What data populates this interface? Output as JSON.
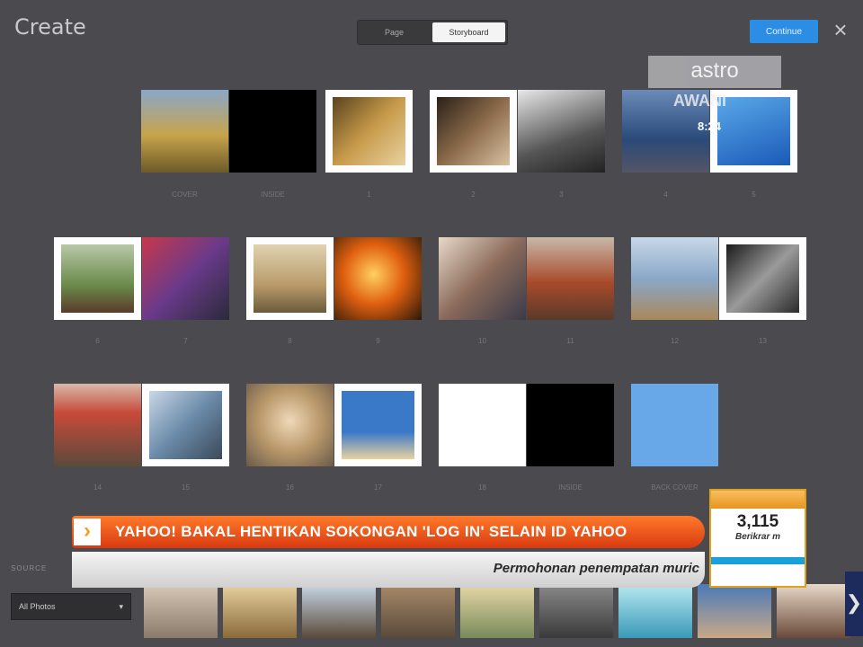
{
  "header": {
    "title": "Create",
    "tabs": [
      {
        "label": "Page",
        "active": false
      },
      {
        "label": "Storyboard",
        "active": true
      }
    ],
    "done_label": "Continue",
    "close_icon": "×"
  },
  "overlay": {
    "brand": "astro",
    "channel": "AWANI",
    "time": "8:24"
  },
  "grid": {
    "rows": [
      {
        "tiles": [
          {
            "name": "cover-front",
            "bg": "linear-gradient(#8aa7c8 0%, #c7a44a 55%, #6d5a2a 100%)",
            "framed": false
          },
          {
            "name": "cover-inside",
            "bg": "#000000",
            "framed": false
          },
          {
            "name": "page-1",
            "bg": "linear-gradient(135deg,#5a4320,#c79a4a,#e8d2a0)",
            "framed": true
          },
          {
            "name": "page-2",
            "bg": "linear-gradient(135deg,#2a2018,#8a6a4a,#d8c2a2)",
            "framed": true
          },
          {
            "name": "page-3",
            "bg": "linear-gradient(160deg,#e8e8e8,#555 60%,#222)",
            "framed": false
          },
          {
            "name": "page-4",
            "bg": "linear-gradient(#6a8ab8,#2a4a7a 60%,#556)",
            "framed": false
          },
          {
            "name": "page-5",
            "bg": "linear-gradient(160deg,#5aa8e8,#1a5ab8)",
            "framed": true
          }
        ],
        "labels": [
          "COVER",
          "INSIDE",
          "1",
          "2",
          "3",
          "4",
          "5"
        ]
      },
      {
        "tiles": [
          {
            "name": "page-6",
            "bg": "linear-gradient(#b8c8a8,#6a8a4a 60%,#5a3a2a)",
            "framed": true
          },
          {
            "name": "page-7",
            "bg": "linear-gradient(135deg,#c8384a,#6a3a8a,#2a2a3a)",
            "framed": false
          },
          {
            "name": "page-8",
            "bg": "linear-gradient(#e0d2b0,#b89a6a 60%,#6a5a3a)",
            "framed": true
          },
          {
            "name": "page-9",
            "bg": "radial-gradient(circle at 45% 45%,#ffd060,#e06010 45%,#2a1808)",
            "framed": false
          },
          {
            "name": "page-10",
            "bg": "linear-gradient(135deg,#e8d8c8,#8a6a5a 50%,#3a3a4a)",
            "framed": false
          },
          {
            "name": "page-11",
            "bg": "linear-gradient(#c8b8a8,#a84a2a 55%,#5a3a2a)",
            "framed": false
          },
          {
            "name": "page-12",
            "bg": "linear-gradient(#c8d8e8,#8aa8c8 50%,#a8885a)",
            "framed": false
          },
          {
            "name": "page-13",
            "bg": "linear-gradient(135deg,#1a1a1a,#9a9a9a,#2a2a2a)",
            "framed": true
          }
        ],
        "labels": [
          "6",
          "7",
          "8",
          "9",
          "10",
          "11",
          "12",
          "13"
        ]
      },
      {
        "tiles": [
          {
            "name": "page-14",
            "bg": "linear-gradient(#d8b8a8,#c84a3a 35%,#5a4a3a)",
            "framed": false
          },
          {
            "name": "page-15",
            "bg": "linear-gradient(135deg,#c8d8e8,#6a8aa8,#3a4a5a)",
            "framed": true
          },
          {
            "name": "page-16",
            "bg": "radial-gradient(circle at 50% 45%,#f0d8b8,#b8986a 50%,#6a5a4a)",
            "framed": false
          },
          {
            "name": "page-17",
            "bg": "linear-gradient(#3a78c8 0%,#3a78c8 60%,#e8d2a0)",
            "framed": true
          },
          {
            "name": "page-18",
            "bg": "#ffffff",
            "framed": false
          },
          {
            "name": "back-inside",
            "bg": "#000000",
            "framed": false
          },
          {
            "name": "back-cover",
            "bg": "#69a8e8",
            "framed": false
          }
        ],
        "labels": [
          "14",
          "15",
          "16",
          "17",
          "18",
          "INSIDE",
          "BACK COVER"
        ]
      }
    ]
  },
  "ticker": {
    "headline": "YAHOO! BAKAL HENTIKAN SOKONGAN 'LOG IN' SELAIN ID YAHOO",
    "subline": "Permohonan penempatan muric",
    "counter_value": "3,115",
    "counter_sub": "Berikrar m"
  },
  "bottom": {
    "source_label": "SOURCE",
    "source_value": "All Photos",
    "next_icon": "❯",
    "strip": [
      "linear-gradient(#d8c8b8,#8a7a6a)",
      "linear-gradient(#e8d2a0,#8a6a3a)",
      "linear-gradient(#c8d8e8,#5a4a3a)",
      "linear-gradient(#a88a6a,#5a4a3a)",
      "linear-gradient(#e8d8a8,#7a8a5a)",
      "linear-gradient(#8a8a8a,#3a3a3a)",
      "linear-gradient(#b8e8f0,#3a9ab8)",
      "linear-gradient(#4a7ab8,#c8a888)",
      "linear-gradient(#e8d8c8,#6a4a3a)"
    ]
  }
}
